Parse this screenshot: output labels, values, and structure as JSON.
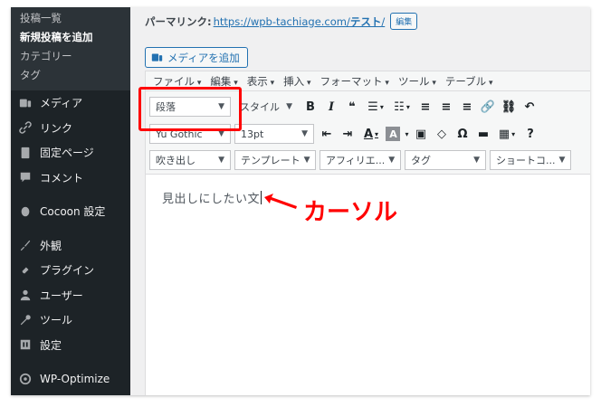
{
  "sidebar": {
    "sub_items": [
      {
        "label": "投稿一覧",
        "current": false
      },
      {
        "label": "新規投稿を追加",
        "current": true
      },
      {
        "label": "カテゴリー",
        "current": false
      },
      {
        "label": "タグ",
        "current": false
      }
    ],
    "menu": [
      {
        "label": "メディア",
        "icon": "media-icon"
      },
      {
        "label": "リンク",
        "icon": "link-icon"
      },
      {
        "label": "固定ページ",
        "icon": "page-icon"
      },
      {
        "label": "コメント",
        "icon": "comment-icon"
      },
      {
        "label": "Cocoon 設定",
        "icon": "cocoon-icon"
      },
      {
        "label": "外観",
        "icon": "appearance-icon"
      },
      {
        "label": "プラグイン",
        "icon": "plugin-icon"
      },
      {
        "label": "ユーザー",
        "icon": "user-icon"
      },
      {
        "label": "ツール",
        "icon": "tool-icon"
      },
      {
        "label": "設定",
        "icon": "settings-icon"
      },
      {
        "label": "WP-Optimize",
        "icon": "wp-optimize-icon"
      }
    ]
  },
  "permalink": {
    "label": "パーマリンク:",
    "url_base": "https://wpb-tachiage.com/",
    "slug": "テスト",
    "url_tail": "/",
    "edit_label": "編集"
  },
  "media_button": "メディアを追加",
  "menubar": [
    "ファイル",
    "編集",
    "表示",
    "挿入",
    "フォーマット",
    "ツール",
    "テーブル"
  ],
  "toolbar": {
    "format_select": "段落",
    "style_select": "スタイル",
    "font_family": "Yu Gothic",
    "font_size": "13pt",
    "row3": [
      "吹き出し",
      "テンプレート",
      "アフィリエ...",
      "タグ",
      "ショートコ..."
    ],
    "glyphs": {
      "bold": "B",
      "italic": "I",
      "quote": "❝",
      "ul": "☰",
      "ol": "☷",
      "align_left": "≡",
      "align_center": "≡",
      "align_right": "≡",
      "link": "🔗",
      "unlink": "⛓",
      "undo": "↶",
      "indent": "⇥",
      "outdent": "⇤",
      "text_color": "A",
      "bg_color": "A",
      "paste": "▣",
      "eraser": "◇",
      "omega": "Ω",
      "hr": "▬",
      "table": "▦",
      "help": "?"
    }
  },
  "content": {
    "text": "見出しにしたい文"
  },
  "annotation": {
    "label": "カーソル",
    "color": "#ff0000"
  },
  "colors": {
    "sidebar_bg": "#1d2327",
    "accent": "#2271b1"
  }
}
